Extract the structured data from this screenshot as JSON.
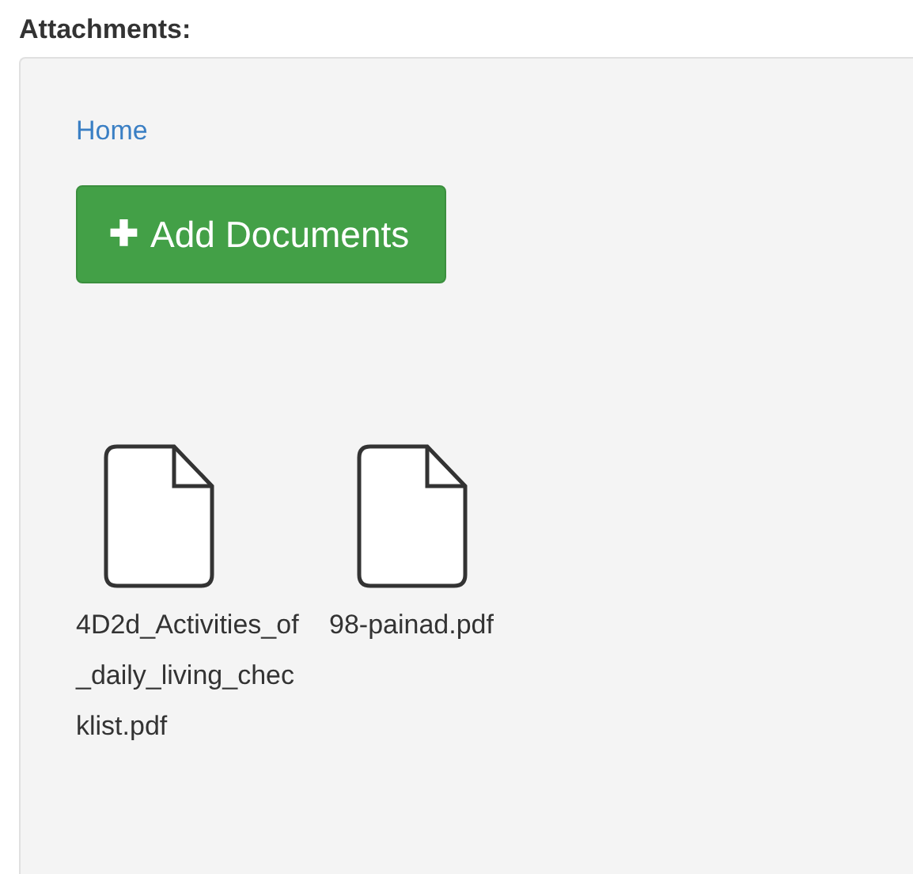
{
  "heading": "Attachments:",
  "breadcrumb": "Home",
  "add_button": {
    "icon": "✚",
    "label": "Add Documents"
  },
  "files": [
    {
      "name": "4D2d_Activities_of_daily_living_checklist.pdf"
    },
    {
      "name": "98-painad.pdf"
    }
  ]
}
